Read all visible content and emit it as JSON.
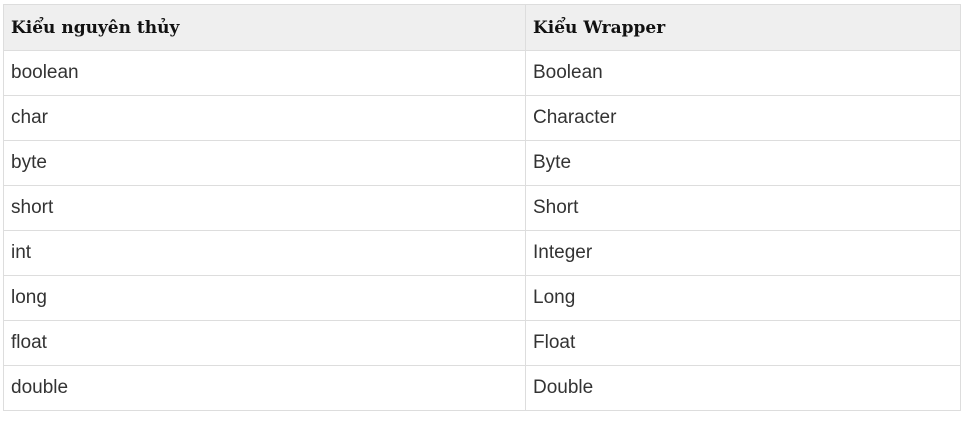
{
  "table": {
    "headers": [
      "Kiểu nguyên thủy",
      "Kiểu Wrapper"
    ],
    "rows": [
      [
        "boolean",
        "Boolean"
      ],
      [
        "char",
        "Character"
      ],
      [
        "byte",
        "Byte"
      ],
      [
        "short",
        "Short"
      ],
      [
        "int",
        "Integer"
      ],
      [
        "long",
        "Long"
      ],
      [
        "float",
        "Float"
      ],
      [
        "double",
        "Double"
      ]
    ]
  }
}
